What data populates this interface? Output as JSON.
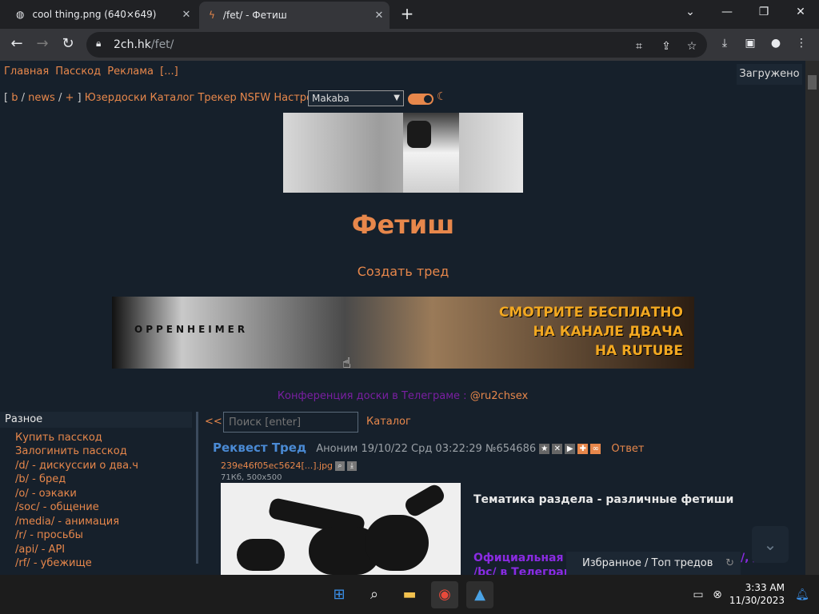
{
  "browser": {
    "tabs": [
      {
        "title": "cool thing.png (640×649)",
        "icon": "globe-icon"
      },
      {
        "title": "/fet/ - Фетиш",
        "icon": "lightning-icon",
        "active": true
      }
    ],
    "url_host": "2ch.hk",
    "url_path": "/fet/"
  },
  "page": {
    "topnav": [
      "Главная",
      "Пасскод",
      "Реклама",
      "[...]"
    ],
    "loaded_label": "Загружено",
    "boardnav": {
      "open_bracket": "[",
      "b": "b",
      "sep1": "/",
      "news": "news",
      "sep2": "/",
      "plus": "+",
      "close_bracket": "]",
      "items": [
        "Юзердоски",
        "Каталог",
        "Трекер",
        "NSFW",
        "Настройки"
      ]
    },
    "style_select": "Makaba",
    "board_title": "Фетиш",
    "create_thread": "Создать тред",
    "banner": {
      "brand": "OPPENHEIMER",
      "lines": [
        "СМОТРИТЕ БЕСПЛАТНО",
        "НА КАНАЛЕ ДВАЧА",
        "НА RUTUBE"
      ]
    },
    "telegram_text": "Конференция доски в Телеграме : ",
    "telegram_link": "@ru2chsex",
    "sidebar": {
      "heading": "Разное",
      "items": [
        "Купить пасскод",
        "Залогинить пасскод",
        "/d/ - дискуссии о два.ч",
        "/b/ - бред",
        "/o/ - оэкаки",
        "/soc/ - общение",
        "/media/ - анимация",
        "/r/ - просьбы",
        "/api/ - API",
        "/rf/ - убежище"
      ]
    },
    "back_link": "<<",
    "search_placeholder": "Поиск [enter]",
    "catalog_link": "Каталог",
    "post": {
      "subject": "Реквест Тред",
      "author": "Аноним",
      "datetime": "19/10/22 Срд 03:22:29",
      "number": "№654686",
      "reply": "Ответ",
      "filename": "239e46f05ec5624[...].jpg",
      "fileinfo": "71Кб, 500x500",
      "text1": "Тематика раздела - различные фетиши",
      "text2": "Официальная к..."
    },
    "fav_panel": "Избранное / Топ тредов",
    "fav_right": "/, /a/,",
    "fav_right2": "/bc/ в Телеграм"
  },
  "taskbar": {
    "time": "3:33 AM",
    "date": "11/30/2023"
  }
}
